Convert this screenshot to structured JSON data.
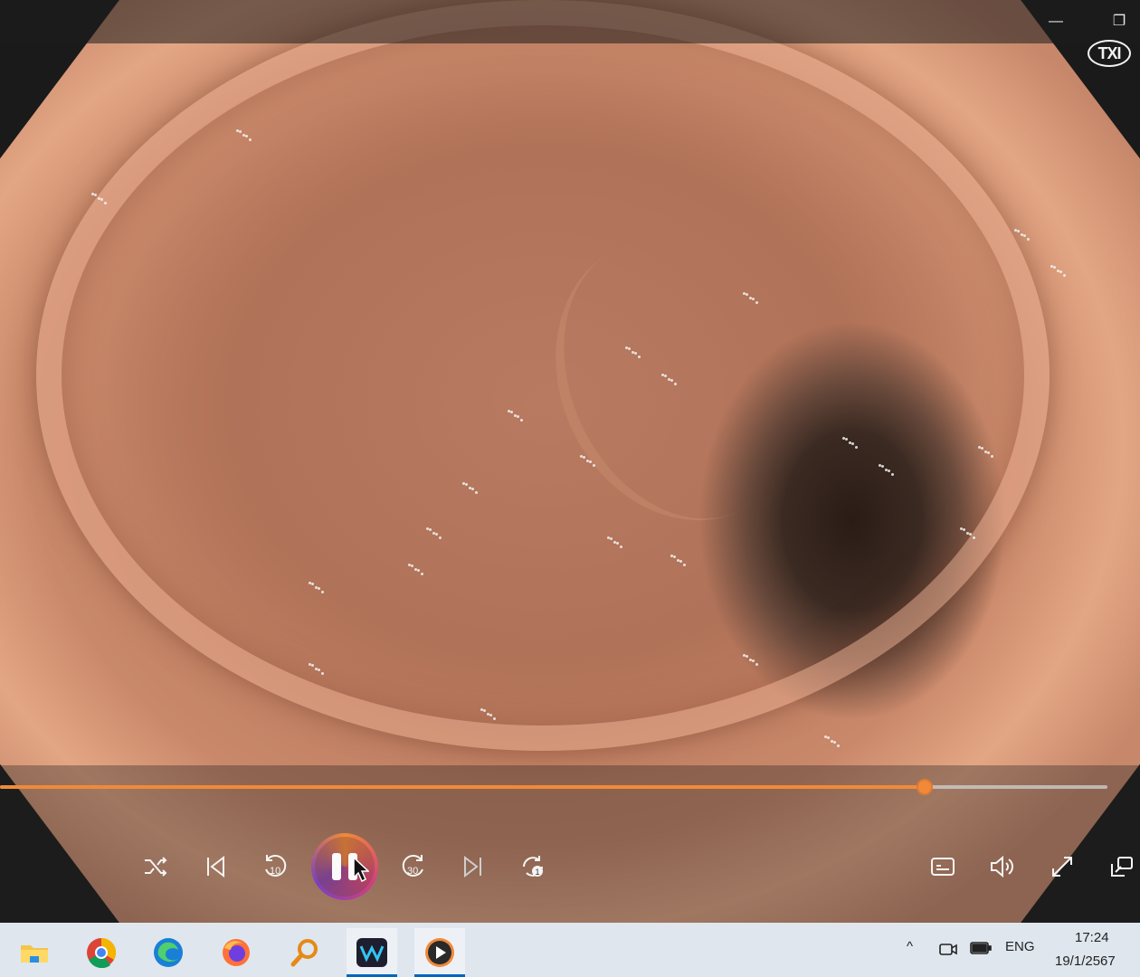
{
  "window": {
    "minimize_glyph": "—",
    "restore_glyph": "❐",
    "overlay_badge": "TXI"
  },
  "player": {
    "progress_fraction": 0.835,
    "controls": [
      {
        "name": "shuffle-icon"
      },
      {
        "name": "previous-icon"
      },
      {
        "name": "skip-back-10-icon",
        "label": "10"
      },
      {
        "name": "pause-icon"
      },
      {
        "name": "skip-forward-30-icon",
        "label": "30"
      },
      {
        "name": "next-icon"
      },
      {
        "name": "repeat-one-icon"
      },
      {
        "name": "captions-icon"
      },
      {
        "name": "volume-icon"
      },
      {
        "name": "fullscreen-icon"
      },
      {
        "name": "mini-player-icon"
      }
    ],
    "accent_color": "#f08a3a"
  },
  "taskbar": {
    "apps": [
      {
        "name": "file-explorer-icon"
      },
      {
        "name": "chrome-icon"
      },
      {
        "name": "edge-icon"
      },
      {
        "name": "firefox-icon"
      },
      {
        "name": "search-magnifier-icon"
      },
      {
        "name": "wondershare-icon"
      },
      {
        "name": "media-player-icon"
      }
    ],
    "tray": {
      "chevron": "^",
      "language": "ENG"
    },
    "clock": {
      "time": "17:24",
      "date": "19/1/2567"
    }
  }
}
